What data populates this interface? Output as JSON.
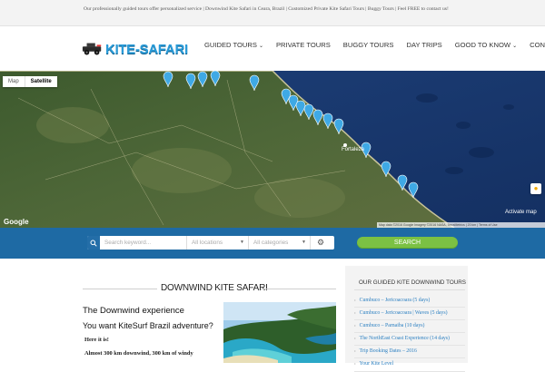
{
  "topbar": {
    "text": "Our professionally guided tours offer personalized service | Downwind Kite Safari in Ceara, Brazil | Customized Private Kite Safari Tours | Buggy Tours | Feel FREE to contact us!"
  },
  "brand": {
    "logo_text": "KITE-SAFARI",
    "color": "#2a9bd8"
  },
  "nav": {
    "items": [
      {
        "label": "GUIDED TOURS",
        "has_caret": true
      },
      {
        "label": "PRIVATE TOURS",
        "has_caret": false
      },
      {
        "label": "BUGGY TOURS",
        "has_caret": false
      },
      {
        "label": "DAY TRIPS",
        "has_caret": false
      },
      {
        "label": "GOOD TO KNOW",
        "has_caret": true
      },
      {
        "label": "CONTACT",
        "has_caret": false
      }
    ],
    "caret": "⌄"
  },
  "map": {
    "type_map": "Map",
    "type_satellite": "Satellite",
    "city_label": "Fortaleza",
    "google_label": "Google",
    "footer_text": "Map data ©2016 Google Imagery ©2016 NASA, TerraMetrics | 20 km | Terms of Use",
    "activate_label": "Activate map",
    "pegman_icon": "pegman-icon"
  },
  "search": {
    "keyword_placeholder": "Search keyword...",
    "locations_label": "All locations",
    "categories_label": "All categories",
    "button_label": "SEARCH",
    "bar_color": "#1e6aa4",
    "button_color": "#7bc143"
  },
  "main": {
    "title": "DOWNWIND KITE SAFARI",
    "heading": "The Downwind experience",
    "subheading": "You want KiteSurf Brazil adventure?",
    "para1": "Here it is!",
    "para2": "Almost 300 km downwind, 300 km of windy"
  },
  "sidebar": {
    "title": "OUR GUIDED KITE DOWNWIND TOURS",
    "items": [
      "Cumbuco – Jericoacoara (5 days)",
      "Cumbuco – Jericoacoara | Waves (5 days)",
      "Cumbuco – Parnaiba (10 days)",
      "The NorthEast Coast Experience (14 days)",
      "Trip Booking Dates – 2016",
      "Your Kite Level"
    ]
  }
}
